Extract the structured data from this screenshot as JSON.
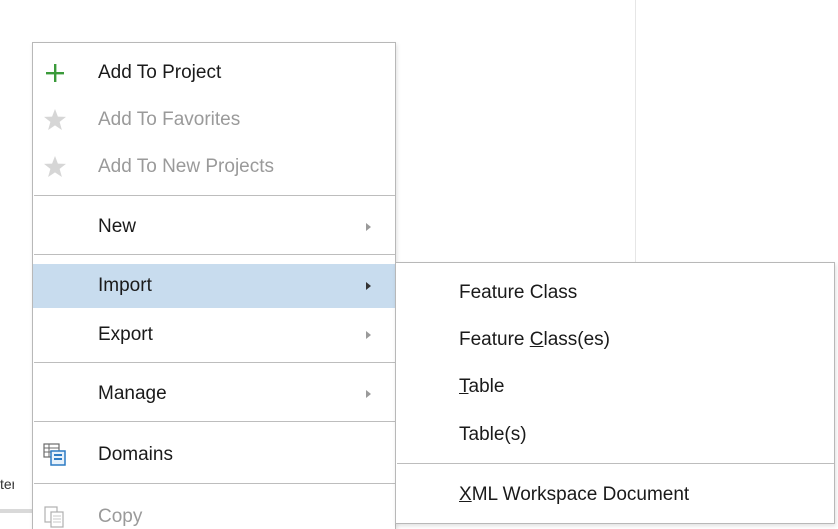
{
  "menu": {
    "items": [
      {
        "id": "add-to-project",
        "label": "Add To Project",
        "icon": "plus-icon",
        "disabled": false
      },
      {
        "id": "add-to-favorites",
        "label": "Add To Favorites",
        "icon": "star-icon",
        "disabled": true
      },
      {
        "id": "add-to-new-projects",
        "label": "Add To New Projects",
        "icon": "star-icon",
        "disabled": true
      },
      {
        "id": "new",
        "label": "New",
        "submenu": true
      },
      {
        "id": "import",
        "label": "Import",
        "submenu": true,
        "highlighted": true
      },
      {
        "id": "export",
        "label": "Export",
        "submenu": true
      },
      {
        "id": "manage",
        "label": "Manage",
        "submenu": true
      },
      {
        "id": "domains",
        "label": "Domains",
        "icon": "domains-icon"
      },
      {
        "id": "copy",
        "label": "Copy",
        "icon": "copy-icon",
        "disabled": true
      }
    ]
  },
  "submenu": {
    "items": [
      {
        "id": "feature-class",
        "label": "Feature Class"
      },
      {
        "id": "feature-classes",
        "pre": "Feature ",
        "mnemonic": "C",
        "post": "lass(es)"
      },
      {
        "id": "table",
        "pre": "",
        "mnemonic": "T",
        "post": "able"
      },
      {
        "id": "tables",
        "label": "Table(s)"
      },
      {
        "id": "xml-workspace",
        "pre": "",
        "mnemonic": "X",
        "post": "ML Workspace Document"
      }
    ]
  },
  "background": {
    "clipped_text": "ter"
  },
  "colors": {
    "highlight": "#c8dcee",
    "plus_green": "#3a9a3a",
    "disabled_text": "#9a9a9a"
  }
}
